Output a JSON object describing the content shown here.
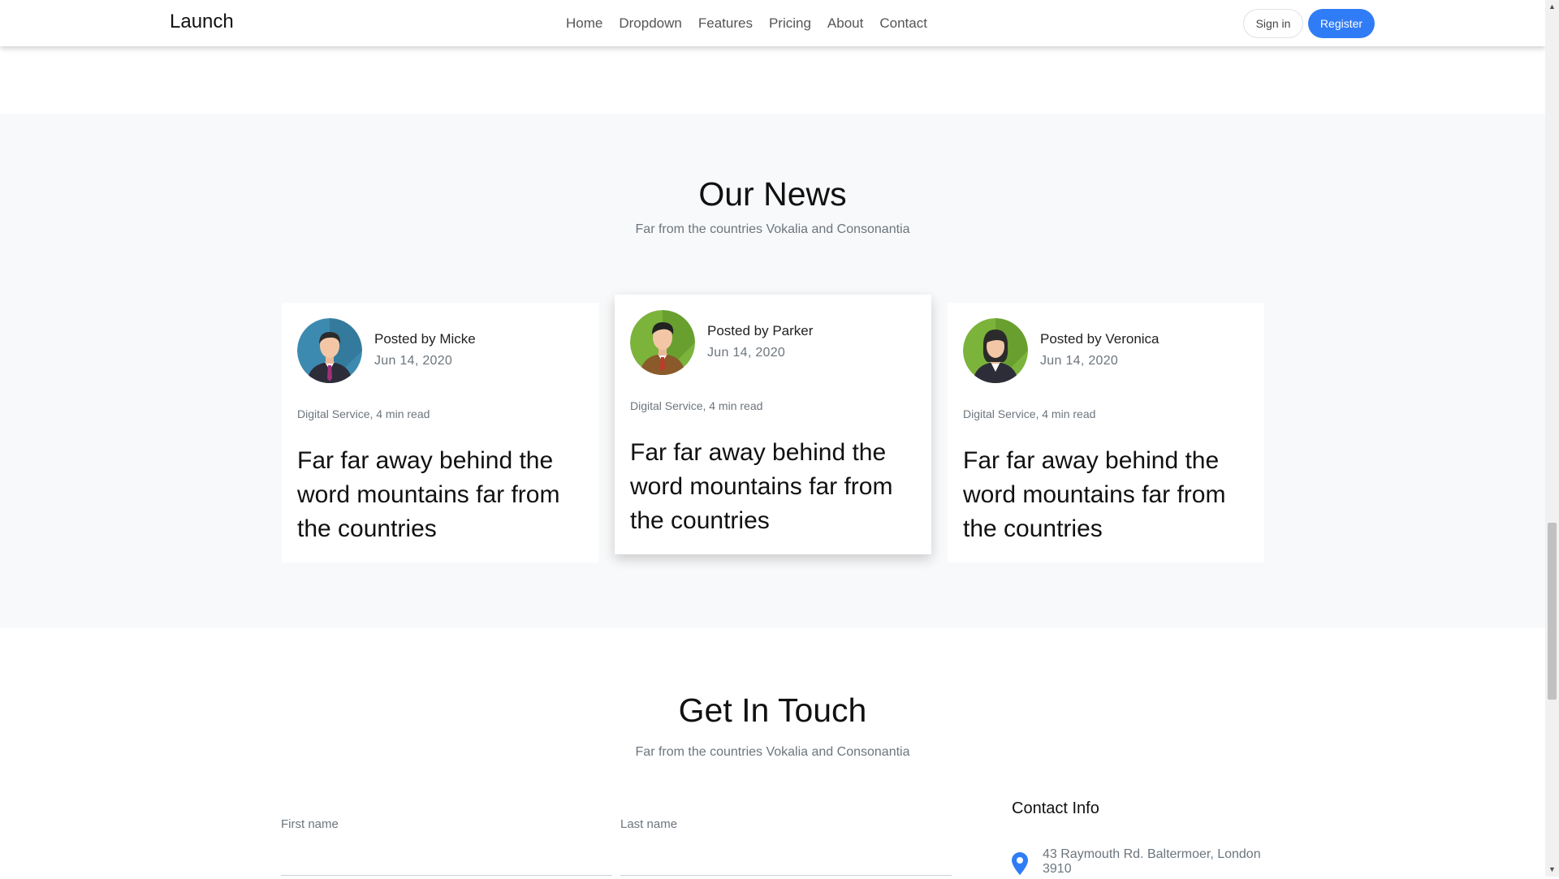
{
  "navbar": {
    "brand": "Launch",
    "links": [
      "Home",
      "Dropdown",
      "Features",
      "Pricing",
      "About",
      "Contact"
    ],
    "signin_label": "Sign in",
    "register_label": "Register"
  },
  "news": {
    "title": "Our News",
    "subtitle": "Far from the countries Vokalia and Consonantia",
    "cards": [
      {
        "posted_prefix": "Posted by",
        "author": "Micke",
        "date": "Jun 14, 2020",
        "meta": "Digital Service, 4 min read",
        "headline": "Far far away behind the word mountains far from the countries"
      },
      {
        "posted_prefix": "Posted by",
        "author": "Parker",
        "date": "Jun 14, 2020",
        "meta": "Digital Service, 4 min read",
        "headline": "Far far away behind the word mountains far from the countries"
      },
      {
        "posted_prefix": "Posted by",
        "author": "Veronica",
        "date": "Jun 14, 2020",
        "meta": "Digital Service, 4 min read",
        "headline": "Far far away behind the word mountains far from the countries"
      }
    ]
  },
  "contact": {
    "title": "Get In Touch",
    "subtitle": "Far from the countries Vokalia and Consonantia",
    "first_name_label": "First name",
    "last_name_label": "Last name",
    "info_title": "Contact Info",
    "address": "43 Raymouth Rd. Baltermoer, London 3910"
  },
  "colors": {
    "accent": "#2f7cf6",
    "section_bg": "#f8f9fa"
  },
  "icons": [
    "location-pin-icon",
    "scroll-up-arrow-icon",
    "scroll-down-arrow-icon"
  ]
}
